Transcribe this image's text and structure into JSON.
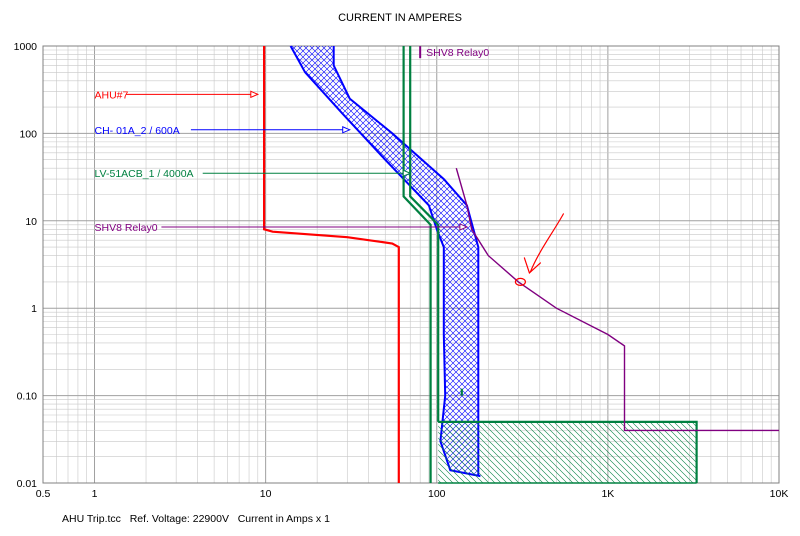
{
  "chart_data": {
    "type": "line",
    "title": "CURRENT IN AMPERES",
    "x_scale": "log",
    "y_scale": "log",
    "xlim": [
      0.5,
      10000
    ],
    "ylim": [
      0.01,
      1000
    ],
    "grid": true,
    "x_tick_labels": [
      {
        "value": 0.5,
        "label": "0.5"
      },
      {
        "value": 1,
        "label": "1"
      },
      {
        "value": 10,
        "label": "10"
      },
      {
        "value": 100,
        "label": "100"
      },
      {
        "value": 1000,
        "label": "1K"
      },
      {
        "value": 10000,
        "label": "10K"
      }
    ],
    "y_tick_labels": [
      {
        "value": 1000,
        "label": "1000"
      },
      {
        "value": 100,
        "label": "100"
      },
      {
        "value": 10,
        "label": "10"
      },
      {
        "value": 1,
        "label": "1"
      },
      {
        "value": 0.1,
        "label": "0.10"
      },
      {
        "value": 0.01,
        "label": "0.01"
      }
    ],
    "colors": {
      "ahu": "#ff0000",
      "ch": "#0000ff",
      "lv": "#008040",
      "relay": "#800080",
      "grid": "#c8c8c8",
      "annotation": "#ff0000"
    },
    "series": [
      {
        "key": "ahu",
        "name": "AHU#7",
        "label_at": [
          1.0,
          280
        ],
        "label_arrow_to": [
          9.0,
          280
        ],
        "curves": [
          [
            [
              9.8,
              1000
            ],
            [
              9.8,
              8.0
            ],
            [
              11,
              7.5
            ],
            [
              30,
              6.5
            ],
            [
              55,
              5.5
            ],
            [
              60,
              5.0
            ],
            [
              60,
              0.01
            ]
          ]
        ],
        "band": null
      },
      {
        "key": "ch",
        "name": "CH- 01A_2 / 600A",
        "label_at": [
          1.0,
          110
        ],
        "label_arrow_to": [
          31,
          110
        ],
        "curves": [],
        "band": {
          "upper": [
            [
              25,
              1000
            ],
            [
              25,
              600
            ],
            [
              31,
              250
            ],
            [
              55,
              100
            ],
            [
              110,
              30
            ],
            [
              150,
              15
            ],
            [
              175,
              5
            ],
            [
              175,
              0.012
            ]
          ],
          "lower": [
            [
              14,
              1000
            ],
            [
              17,
              500
            ],
            [
              28,
              170
            ],
            [
              50,
              50
            ],
            [
              90,
              15
            ],
            [
              100,
              8
            ],
            [
              110,
              5
            ],
            [
              110,
              0.5
            ],
            [
              112,
              0.1
            ],
            [
              105,
              0.03
            ],
            [
              120,
              0.014
            ],
            [
              180,
              0.012
            ]
          ]
        }
      },
      {
        "key": "lv",
        "name": "LV-51ACB_1 / 4000A",
        "label_at": [
          1.0,
          35
        ],
        "label_arrow_to": [
          70,
          35
        ],
        "curves": [
          [
            [
              64,
              1000
            ],
            [
              64,
              19
            ],
            [
              92,
              9
            ],
            [
              92,
              0.01
            ]
          ],
          [
            [
              70,
              1000
            ],
            [
              70,
              19
            ],
            [
              102,
              9
            ],
            [
              102,
              0.05
            ]
          ],
          [
            [
              102,
              0.05
            ],
            [
              3300,
              0.05
            ],
            [
              3300,
              0.01
            ]
          ],
          [
            [
              140,
              0.12
            ],
            [
              140,
              0.1
            ]
          ]
        ],
        "band": {
          "upper": [
            [
              102,
              0.05
            ],
            [
              3300,
              0.05
            ]
          ],
          "lower": [
            [
              102,
              0.01
            ],
            [
              3300,
              0.01
            ]
          ]
        }
      },
      {
        "key": "relay",
        "name": "SHV8 Relay0",
        "label_at": [
          1.0,
          8.5
        ],
        "label_arrow_to": [
          150,
          8.5
        ],
        "curves": [
          [
            [
              130,
              40
            ],
            [
              150,
              15
            ],
            [
              160,
              8
            ],
            [
              200,
              4
            ],
            [
              300,
              2
            ],
            [
              500,
              1
            ],
            [
              1000,
              0.5
            ],
            [
              1250,
              0.37
            ],
            [
              1250,
              0.04
            ],
            [
              10000,
              0.04
            ]
          ]
        ],
        "band": null
      }
    ],
    "legend_top": {
      "name": "SHV8 Relay0",
      "at": [
        80,
        850
      ]
    },
    "annotation": {
      "type": "hand-drawn-arrow",
      "points_at": [
        300,
        2
      ]
    }
  },
  "footer": {
    "file": "AHU Trip.tcc",
    "ref_voltage": "Ref. Voltage: 22900V",
    "current_scale": "Current in Amps x 1"
  }
}
